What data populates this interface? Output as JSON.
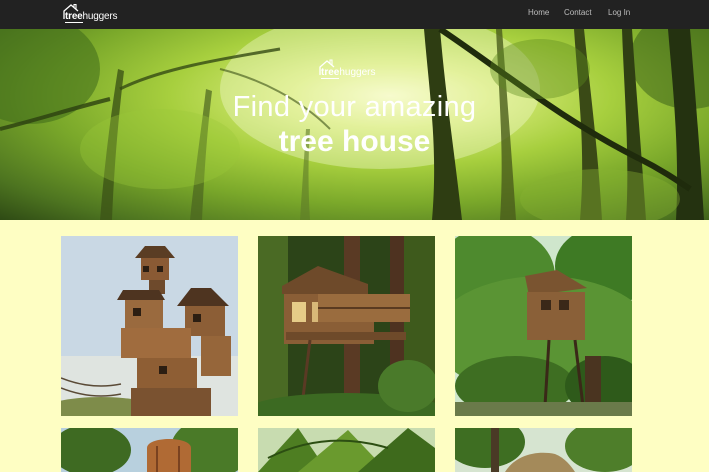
{
  "brand": {
    "name_bold": "tree",
    "name_light": "huggers"
  },
  "nav": {
    "links": [
      {
        "label": "Home"
      },
      {
        "label": "Contact"
      },
      {
        "label": "Log In"
      }
    ]
  },
  "hero": {
    "logo_bold": "tree",
    "logo_light": "huggers",
    "headline_line1": "Find your amazing",
    "headline_line2": "tree house"
  },
  "colors": {
    "navbar": "#222222",
    "page_background": "#fefec3",
    "nav_link": "#bdbdbd"
  },
  "gallery": {
    "items": [
      {
        "subject": "tall multi-level tree house tower with rope bridge"
      },
      {
        "subject": "wooden tree house with balcony among redwoods"
      },
      {
        "subject": "elevated cabin in green forest canopy"
      },
      {
        "subject": "tree house partially visible"
      },
      {
        "subject": "palm tree canopy"
      },
      {
        "subject": "tree house with thatched roof"
      }
    ]
  }
}
